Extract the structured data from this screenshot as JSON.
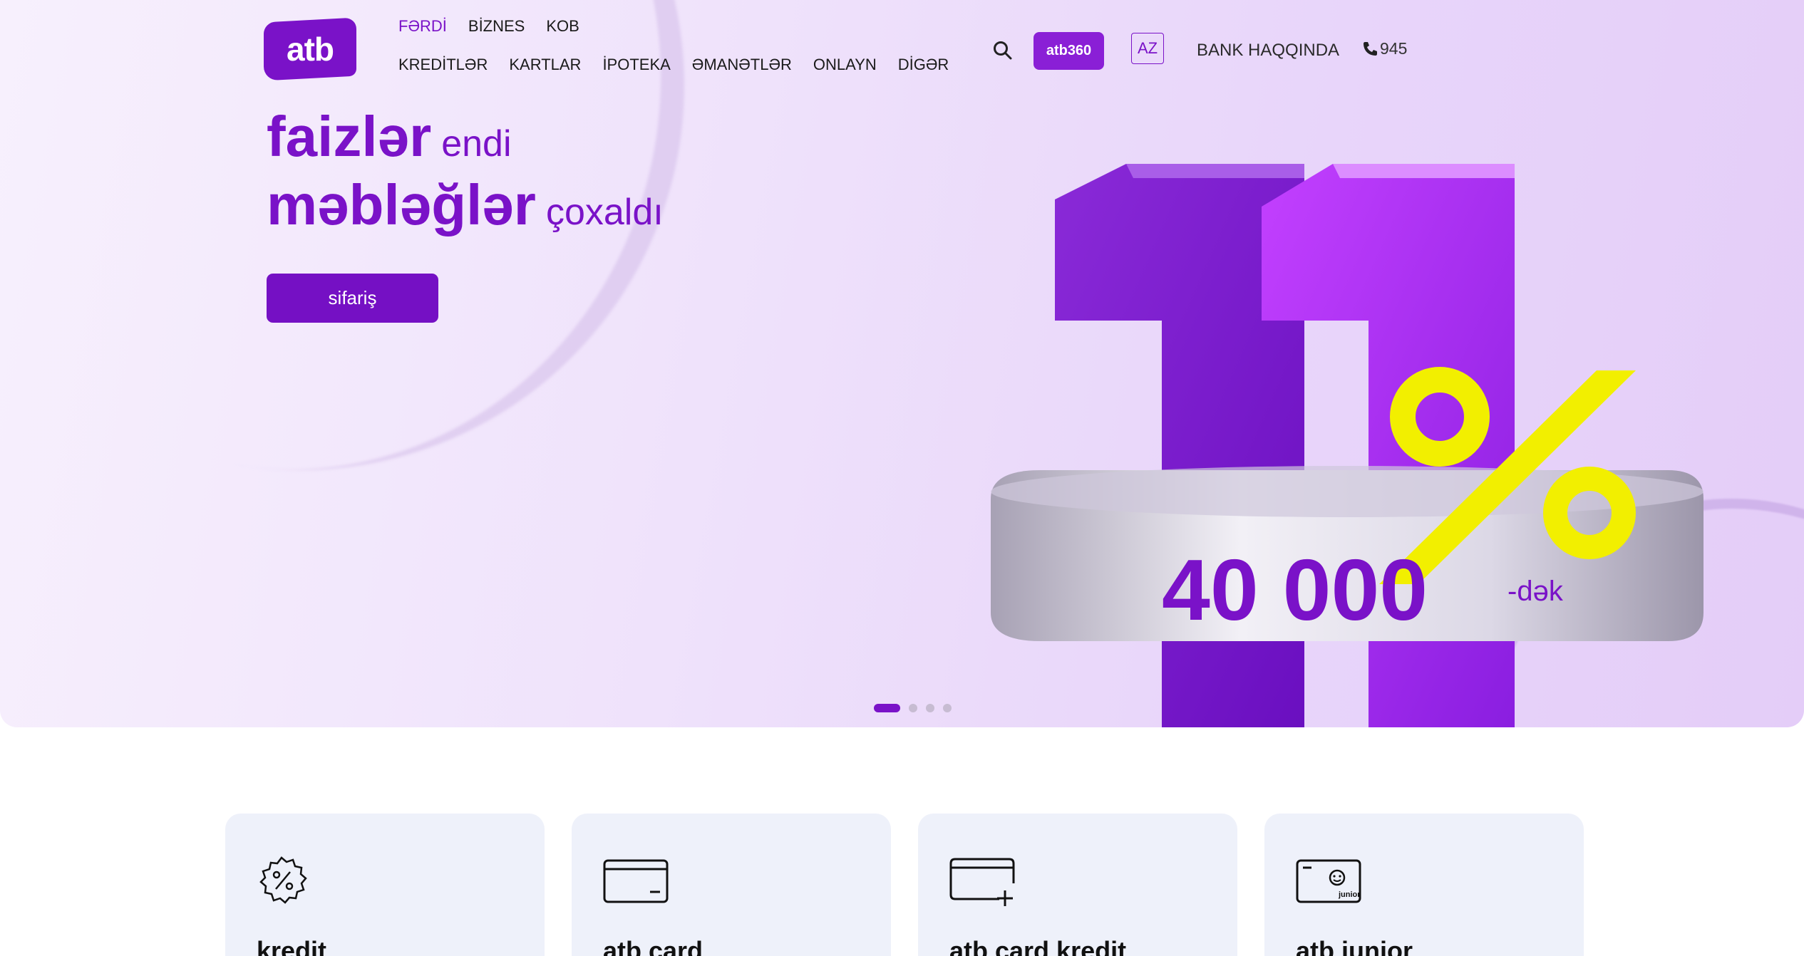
{
  "brand": {
    "logo_text": "atb",
    "accent": "#7a12c8"
  },
  "nav_top": [
    "FƏRDİ",
    "BİZNES",
    "KOB"
  ],
  "nav_main": [
    "KREDİTLƏR",
    "KARTLAR",
    "İPOTEKA",
    "ƏMANƏTLƏR",
    "ONLAYN",
    "DİGƏR"
  ],
  "header": {
    "atb360_label": "atb360",
    "lang_label": "AZ",
    "about_label": "BANK HAQQINDA",
    "phone_label": "945"
  },
  "hero": {
    "line1_big": "faizlər",
    "line1_small": "endi",
    "line2_big": "məbləğlər",
    "line2_small": "çoxaldı",
    "button_label": "sifariş",
    "graphic_number": "11",
    "graphic_percent": "%",
    "graphic_amount": "40 000",
    "graphic_suffix": "-dək",
    "slides_total": 4,
    "slide_active": 1
  },
  "cards": [
    {
      "title": "kredit",
      "icon": "percent-badge-icon"
    },
    {
      "title": "atb card",
      "icon": "credit-card-icon"
    },
    {
      "title": "atb card kredit",
      "icon": "card-plus-icon"
    },
    {
      "title": "atb junior",
      "icon": "junior-card-icon"
    }
  ],
  "icons": {
    "search": "search-icon",
    "phone": "phone-icon"
  }
}
